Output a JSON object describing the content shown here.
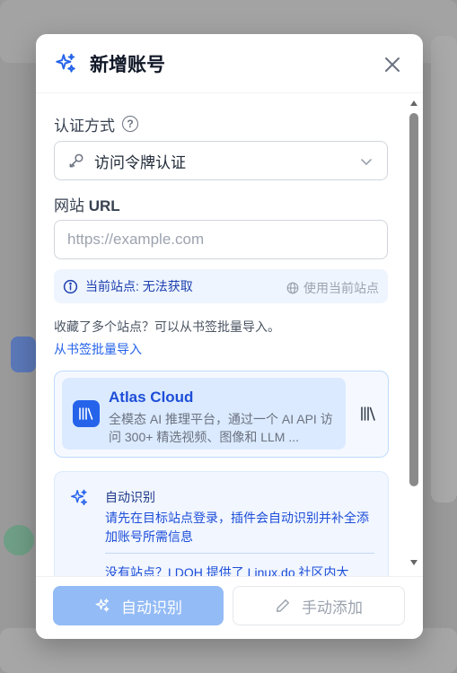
{
  "dialog": {
    "title": "新增账号",
    "accent": "#2563eb"
  },
  "form": {
    "auth_label": "认证方式",
    "auth_value": "访问令牌认证",
    "site_label_prefix": "网站 ",
    "site_label_strong": "URL",
    "site_placeholder": "https://example.com",
    "site_value": "",
    "current_site_text": "当前站点: 无法获取",
    "use_current_site": "使用当前站点"
  },
  "bookmark": {
    "hint": "收藏了多个站点？可以从书签批量导入。",
    "link": "从书签批量导入"
  },
  "recommended": {
    "name": "Atlas Cloud",
    "description": "全模态 AI 推理平台，通过一个 AI API 访问 300+ 精选视频、图像和 LLM ..."
  },
  "auto_detect": {
    "title": "自动识别",
    "text": "请先在目标站点登录，插件会自动识别并补全添加账号所需信息",
    "more": "没有站点？LDOH 提供了 Linux.do 社区内大"
  },
  "footer": {
    "auto_button": "自动识别",
    "manual_button": "手动添加"
  }
}
